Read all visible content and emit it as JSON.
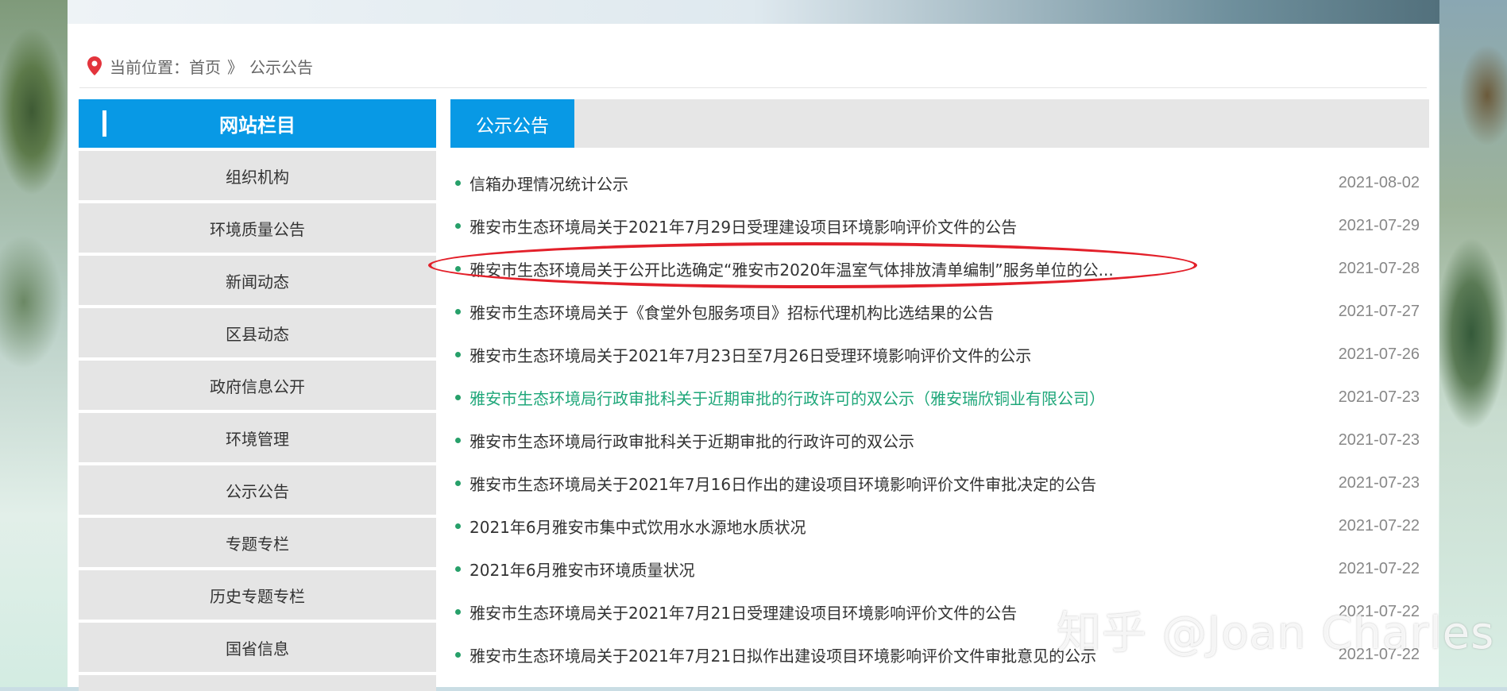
{
  "breadcrumb": {
    "prefix": "当前位置：",
    "home": "首页",
    "separator": "》",
    "current": "公示公告"
  },
  "sidebar": {
    "title": "网站栏目",
    "items": [
      {
        "label": "组织机构"
      },
      {
        "label": "环境质量公告"
      },
      {
        "label": "新闻动态"
      },
      {
        "label": "区县动态"
      },
      {
        "label": "政府信息公开"
      },
      {
        "label": "环境管理"
      },
      {
        "label": "公示公告"
      },
      {
        "label": "专题专栏"
      },
      {
        "label": "历史专题专栏"
      },
      {
        "label": "国省信息"
      }
    ]
  },
  "main": {
    "tab": "公示公告",
    "news": [
      {
        "title": "信箱办理情况统计公示",
        "date": "2021-08-02"
      },
      {
        "title": "雅安市生态环境局关于2021年7月29日受理建设项目环境影响评价文件的公告",
        "date": "2021-07-29"
      },
      {
        "title": "雅安市生态环境局关于公开比选确定“雅安市2020年温室气体排放清单编制”服务单位的公...",
        "date": "2021-07-28"
      },
      {
        "title": "雅安市生态环境局关于《食堂外包服务项目》招标代理机构比选结果的公告",
        "date": "2021-07-27"
      },
      {
        "title": "雅安市生态环境局关于2021年7月23日至7月26日受理环境影响评价文件的公示",
        "date": "2021-07-26"
      },
      {
        "title": "雅安市生态环境局行政审批科关于近期审批的行政许可的双公示（雅安瑞欣铜业有限公司）",
        "date": "2021-07-23"
      },
      {
        "title": "雅安市生态环境局行政审批科关于近期审批的行政许可的双公示",
        "date": "2021-07-23"
      },
      {
        "title": "雅安市生态环境局关于2021年7月16日作出的建设项目环境影响评价文件审批决定的公告",
        "date": "2021-07-23"
      },
      {
        "title": "2021年6月雅安市集中式饮用水水源地水质状况",
        "date": "2021-07-22"
      },
      {
        "title": "2021年6月雅安市环境质量状况",
        "date": "2021-07-22"
      },
      {
        "title": "雅安市生态环境局关于2021年7月21日受理建设项目环境影响评价文件的公告",
        "date": "2021-07-22"
      },
      {
        "title": "雅安市生态环境局关于2021年7月21日拟作出建设项目环境影响评价文件审批意见的公示",
        "date": "2021-07-22"
      }
    ]
  },
  "watermark": "知乎 @Joan Charles",
  "colors": {
    "accent": "#0899e5",
    "bullet": "#27a06a",
    "hover_link": "#1fa77a",
    "highlight": "#e3202a"
  }
}
